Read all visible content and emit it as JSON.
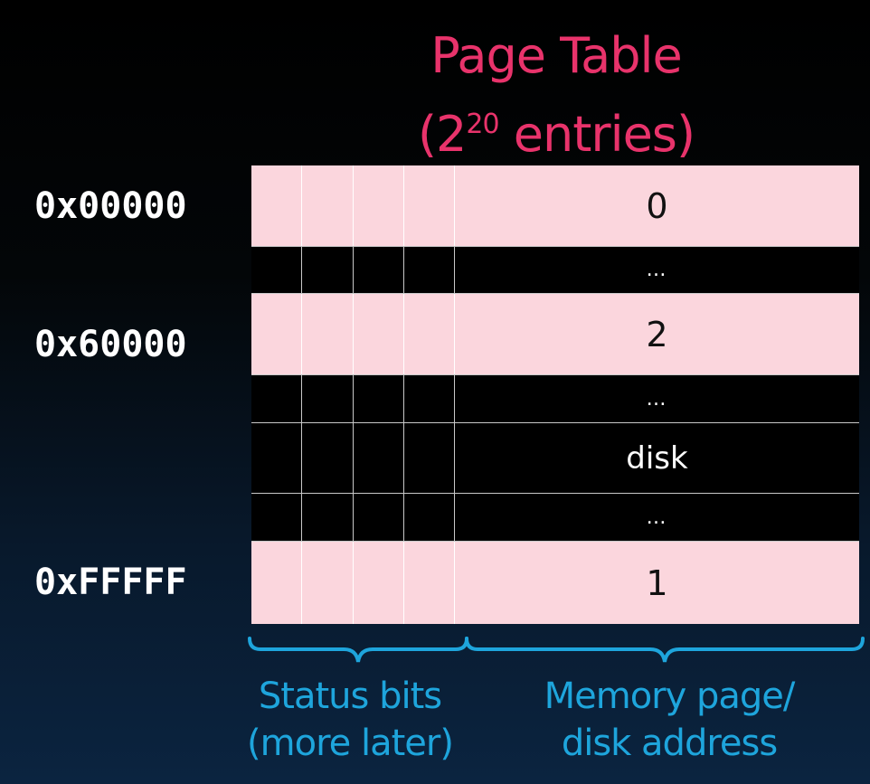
{
  "title": {
    "line1": "Page Table",
    "line2_prefix": "(2",
    "line2_exponent": "20",
    "line2_suffix": " entries)"
  },
  "addresses": [
    "0x00000",
    "0x60000",
    "0xFFFFF"
  ],
  "rows": [
    {
      "value": "0",
      "shade": "pink"
    },
    {
      "value": "…",
      "shade": "dark"
    },
    {
      "value": "2",
      "shade": "pink"
    },
    {
      "value": "…",
      "shade": "dark"
    },
    {
      "value": "disk",
      "shade": "dark"
    },
    {
      "value": "…",
      "shade": "dark"
    },
    {
      "value": "1",
      "shade": "pink"
    }
  ],
  "captions": {
    "status_line1": "Status bits",
    "status_line2": "(more later)",
    "memory_line1": "Memory page/",
    "memory_line2": "disk address"
  },
  "colors": {
    "title": "#e8336b",
    "caption": "#1ea5dc",
    "pink_row": "#fbd6dd",
    "dark_row": "#000000"
  }
}
